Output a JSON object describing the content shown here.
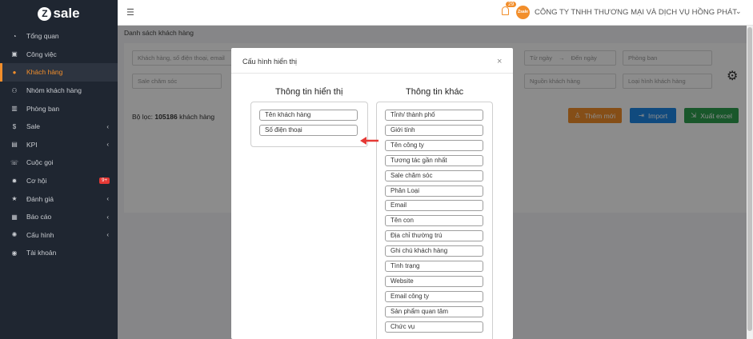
{
  "app": {
    "logo_text": "sale",
    "logo_letter": "Z"
  },
  "sidebar": {
    "items": [
      {
        "label": "Tổng quan",
        "icon": "dashboard-icon"
      },
      {
        "label": "Công việc",
        "icon": "briefcase-icon"
      },
      {
        "label": "Khách hàng",
        "icon": "user-icon",
        "active": true
      },
      {
        "label": "Nhóm khách hàng",
        "icon": "users-icon"
      },
      {
        "label": "Phòng ban",
        "icon": "building-icon"
      },
      {
        "label": "Sale",
        "icon": "dollar-icon",
        "chevron": true
      },
      {
        "label": "KPI",
        "icon": "chart-icon",
        "chevron": true
      },
      {
        "label": "Cuộc gọi",
        "icon": "phone-icon"
      },
      {
        "label": "Cơ hội",
        "icon": "gear-icon",
        "badge": "9+"
      },
      {
        "label": "Đánh giá",
        "icon": "star-icon",
        "chevron": true
      },
      {
        "label": "Báo cáo",
        "icon": "report-icon",
        "chevron": true
      },
      {
        "label": "Cấu hình",
        "icon": "cogs-icon",
        "chevron": true
      },
      {
        "label": "Tài khoản",
        "icon": "account-icon"
      }
    ]
  },
  "header": {
    "notification_count": "29",
    "avatar_text": "Zsale",
    "company": "CÔNG TY TNHH THƯƠNG MẠI VÀ DỊCH VỤ HỒNG PHÁT"
  },
  "page": {
    "breadcrumb": "Danh sách khách hàng",
    "search_placeholder": "Khách hàng, số điện thoại, email",
    "date_from": "Từ ngày",
    "date_to": "Đến ngày",
    "dept_placeholder": "Phòng ban",
    "sale_care_placeholder": "Sale chăm sóc",
    "source_placeholder": "Nguồn khách hàng",
    "type_placeholder": "Loại hình khách hàng",
    "filter_prefix": "Bộ lọc:",
    "filter_count": "105186",
    "filter_suffix": "khách hàng",
    "btn_add": "Thêm mới",
    "btn_import": "Import",
    "btn_export": "Xuất excel"
  },
  "modal": {
    "title": "Cấu hình hiển thị",
    "close": "×",
    "left_title": "Thông tin hiển thị",
    "right_title": "Thông tin khác",
    "shown_fields": [
      "Tên khách hàng",
      "Số điện thoại"
    ],
    "other_fields": [
      "Tỉnh/ thành phố",
      "Giới tính",
      "Tên công ty",
      "Tương tác gần nhất",
      "Sale chăm sóc",
      "Phân Loại",
      "Email",
      "Tên con",
      "Địa chỉ thường trú",
      "Ghi chú khách hàng",
      "Tình trạng",
      "Website",
      "Email công ty",
      "Sản phẩm quan tâm",
      "Chức vụ"
    ]
  },
  "colors": {
    "accent": "#f28e2b",
    "sidebar_bg": "#1f2631",
    "arrow": "#e53935"
  }
}
